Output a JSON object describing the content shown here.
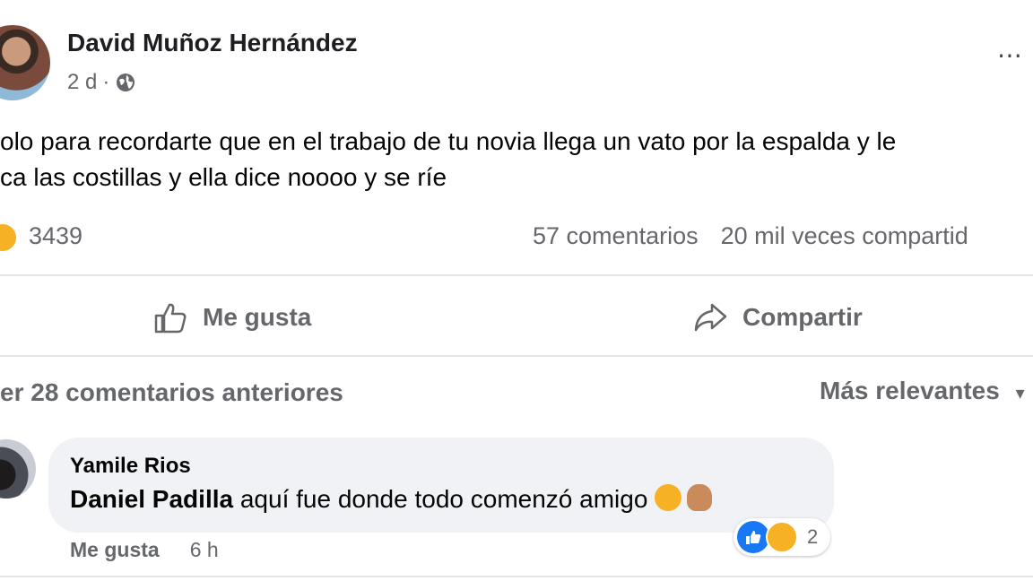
{
  "post": {
    "author": "David Muñoz Hernández",
    "time": "2 d",
    "separator": "·",
    "text_line1": "olo para recordarte que en el trabajo de tu novia llega un vato por la espalda y le",
    "text_line2": "ca las costillas y ella dice noooo y se ríe",
    "reactions_count": "3439",
    "comments_count": "57 comentarios",
    "shares": "20 mil veces compartid",
    "more_icon": "⋯"
  },
  "actions": {
    "like_label": "Me gusta",
    "share_label": "Compartir"
  },
  "comments_bar": {
    "previous": "er 28 comentarios anteriores",
    "sort": "Más relevantes",
    "sort_arrow": "▾"
  },
  "comment": {
    "author": "Yamile Rios",
    "mention": "Daniel Padilla",
    "text": " aquí fue donde todo comenzó amigo",
    "reaction_count": "2",
    "like_label": "Me gusta",
    "time": "6 h"
  },
  "colors": {
    "primary_text": "#050505",
    "secondary_text": "#65676b",
    "bubble": "#f0f2f5",
    "like_blue": "#1877f2",
    "haha_yellow": "#f7b125"
  }
}
